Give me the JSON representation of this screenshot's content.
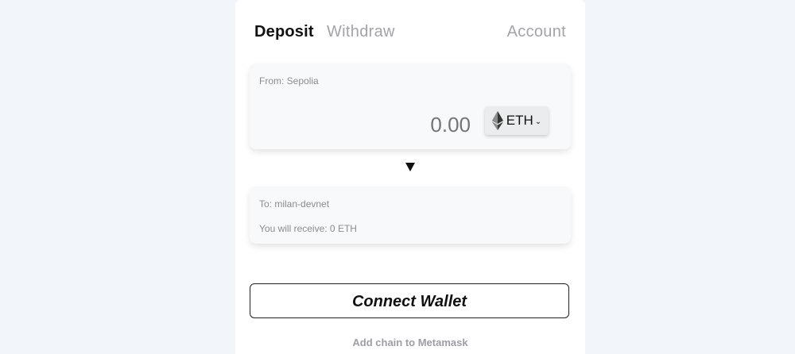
{
  "tabs": {
    "deposit": "Deposit",
    "withdraw": "Withdraw",
    "account": "Account"
  },
  "from_panel": {
    "label": "From: Sepolia",
    "amount_value": "",
    "amount_placeholder": "0.00",
    "token": {
      "symbol": "ETH",
      "icon": "ethereum-icon",
      "dropdown_icon": "chevron-down-icon"
    }
  },
  "direction_icon": "arrow-down-icon",
  "to_panel": {
    "label": "To: milan-devnet",
    "receive_text": "You will receive: 0 ETH"
  },
  "actions": {
    "connect_wallet": "Connect Wallet",
    "add_chain": "Add chain to Metamask"
  },
  "colors": {
    "page_background": "#f2f6fa",
    "card_background": "#ffffff",
    "panel_background": "#f8f9fb",
    "inactive_tab": "#a3a3a8",
    "muted_text": "#8b8b93"
  }
}
